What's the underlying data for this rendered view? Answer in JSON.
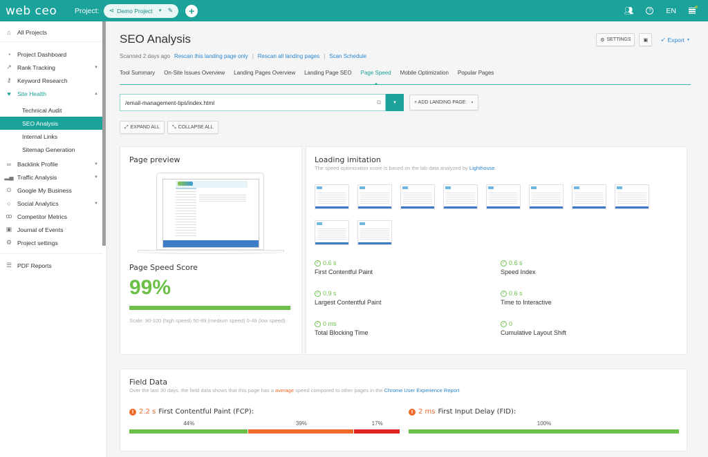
{
  "topbar": {
    "logo": "web ceo",
    "project_label": "Project:",
    "project_name": "Demo Project",
    "language": "EN",
    "accent": "#1aa29b"
  },
  "sidebar": {
    "items": [
      {
        "label": "All Projects",
        "icon": "home-icon"
      },
      {
        "label": "Project Dashboard",
        "icon": "dashboard-icon"
      },
      {
        "label": "Rank Tracking",
        "icon": "chart-icon",
        "chevron": "down"
      },
      {
        "label": "Keyword Research",
        "icon": "key-icon"
      },
      {
        "label": "Site Health",
        "icon": "heart-icon",
        "chevron": "up"
      },
      {
        "label": "Technical Audit"
      },
      {
        "label": "SEO Analysis"
      },
      {
        "label": "Internal Links"
      },
      {
        "label": "Sitemap Generation"
      },
      {
        "label": "Backlink Profile",
        "icon": "link-icon",
        "chevron": "down"
      },
      {
        "label": "Traffic Analysis",
        "icon": "bars-icon",
        "chevron": "down"
      },
      {
        "label": "Google My Business",
        "icon": "pin-icon"
      },
      {
        "label": "Social Analytics",
        "icon": "chat-icon",
        "chevron": "down"
      },
      {
        "label": "Competitor Metrics",
        "icon": "binoculars-icon"
      },
      {
        "label": "Journal of Events",
        "icon": "calendar-icon"
      },
      {
        "label": "Project settings",
        "icon": "gear-icon"
      },
      {
        "label": "PDF Reports",
        "icon": "report-icon"
      }
    ]
  },
  "header": {
    "title": "SEO Analysis",
    "scanned": "Scanned 2 days ago",
    "rescan_one": "Rescan this landing page only",
    "rescan_all": "Rescan all landing pages",
    "schedule": "Scan Schedule",
    "sep": "|",
    "settings_label": "SETTINGS",
    "export_label": "Export"
  },
  "tabs": [
    "Tool Summary",
    "On-Site Issues Overview",
    "Landing Pages Overview",
    "Landing Page SEO",
    "Page Speed",
    "Mobile Optimization",
    "Popular Pages"
  ],
  "active_tab": "Page Speed",
  "controls": {
    "url": "/email-management-tips/index.html",
    "add_landing_page": "+ ADD LANDING PAGE",
    "expand_all": "EXPAND ALL",
    "collapse_all": "COLLAPSE ALL"
  },
  "preview": {
    "title": "Page preview",
    "score_title": "Page Speed Score",
    "score": "99%",
    "score_fraction": 0.99,
    "scale": "Scale: 90-100 (high speed) 50-89 (medium speed) 0-49 (low speed)",
    "good_color": "#6cc04a"
  },
  "loading": {
    "title": "Loading imitation",
    "subtitle": "The speed optimization score is based on the lab data analyzed by",
    "link": "Lighthouse",
    "period": ".",
    "frame_count": 10,
    "metrics": [
      {
        "value": "0.6 s",
        "label": "First Contentful Paint"
      },
      {
        "value": "0.6 s",
        "label": "Speed Index"
      },
      {
        "value": "0.9 s",
        "label": "Largest Contentful Paint"
      },
      {
        "value": "0.6 s",
        "label": "Time to Interactive"
      },
      {
        "value": "0 ms",
        "label": "Total Blocking Time"
      },
      {
        "value": "0",
        "label": "Cumulative Layout Shift"
      }
    ]
  },
  "field": {
    "title": "Field Data",
    "desc_1": "Over the last 30 days, the field data shows that this page has a",
    "desc_avg": "average",
    "desc_2": "speed compared to other pages in the",
    "desc_link": "Chrome User Experience Report",
    "fcp": {
      "value": "2.2 s",
      "label": "First Contentful Paint (FCP):",
      "segments": [
        {
          "pct": 44,
          "label": "44%",
          "color": "#6cc04a"
        },
        {
          "pct": 39,
          "label": "39%",
          "color": "#f0692a"
        },
        {
          "pct": 17,
          "label": "17%",
          "color": "#e02424"
        }
      ]
    },
    "fid": {
      "value": "2 ms",
      "label": "First Input Delay (FID):",
      "segments": [
        {
          "pct": 100,
          "label": "100%",
          "color": "#6cc04a"
        }
      ]
    }
  }
}
